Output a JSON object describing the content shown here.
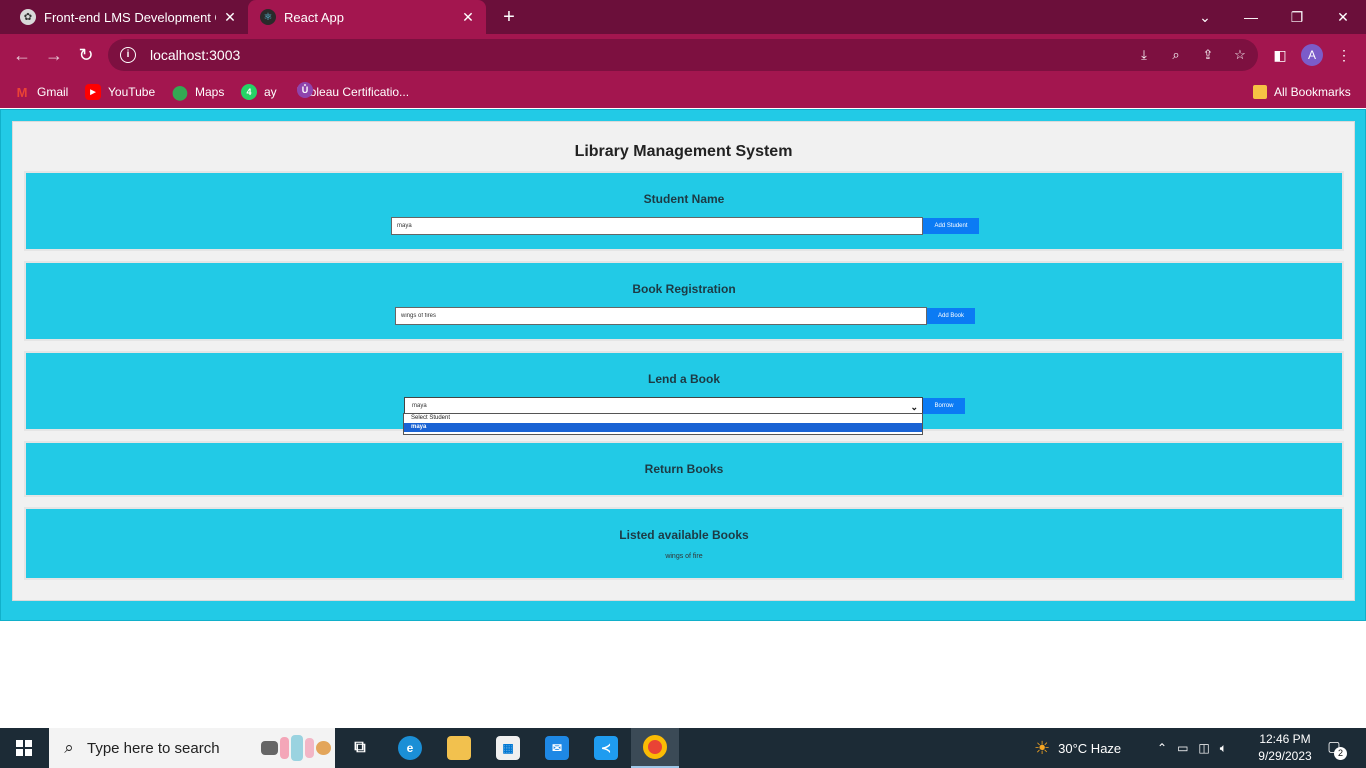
{
  "browser": {
    "tabs": [
      {
        "title": "Front-end LMS Development Gu",
        "active": false
      },
      {
        "title": "React App",
        "active": true
      }
    ],
    "address": "localhost:3003",
    "bookmarks": [
      {
        "label": "Gmail",
        "icon": "gmail-icon"
      },
      {
        "label": "YouTube",
        "icon": "youtube-icon"
      },
      {
        "label": "Maps",
        "icon": "maps-icon"
      },
      {
        "label": "ay",
        "icon": "whatsapp-icon",
        "badge": "4"
      },
      {
        "label": "Tableau Certificatio...",
        "icon": "tableau-icon"
      }
    ],
    "all_bookmarks": "All Bookmarks",
    "profile_initial": "A"
  },
  "app": {
    "title": "Library Management System",
    "student": {
      "heading": "Student Name",
      "input_value": "maya",
      "button": "Add Student"
    },
    "book": {
      "heading": "Book Registration",
      "input_value": "wings of fires",
      "button": "Add Book"
    },
    "lend": {
      "heading": "Lend a Book",
      "selected": "maya",
      "options": [
        "Select Student",
        "maya"
      ],
      "button": "Borrow"
    },
    "return": {
      "heading": "Return Books"
    },
    "listed": {
      "heading": "Listed available Books",
      "books": [
        "wings of fire"
      ]
    }
  },
  "taskbar": {
    "search_placeholder": "Type here to search",
    "weather": "30°C  Haze",
    "time": "12:46 PM",
    "date": "9/29/2023",
    "notifications": "2"
  },
  "colors": {
    "chrome_dark": "#6b0f3a",
    "chrome": "#a3164f",
    "page_bg": "#22cae6",
    "panel_bg": "#f1f1f1",
    "button": "#0b7bf4"
  }
}
